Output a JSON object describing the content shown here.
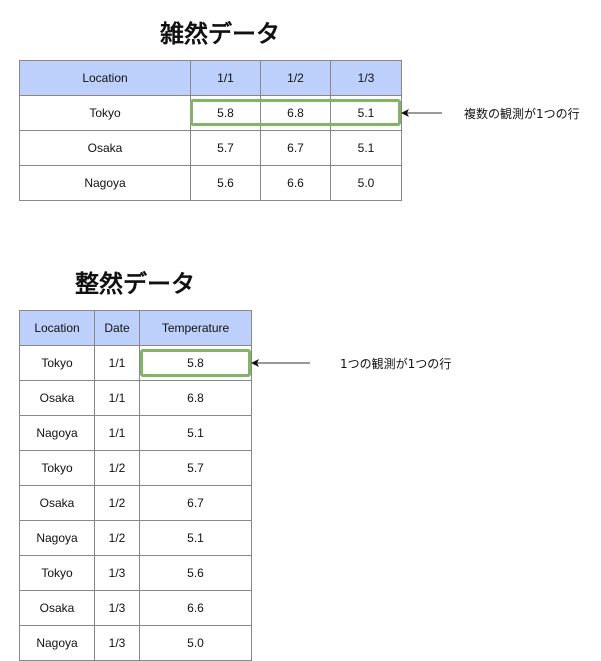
{
  "messy": {
    "title": "雑然データ",
    "headers": [
      "Location",
      "1/1",
      "1/2",
      "1/3"
    ],
    "rows": [
      [
        "Tokyo",
        "5.8",
        "6.8",
        "5.1"
      ],
      [
        "Osaka",
        "5.7",
        "6.7",
        "5.1"
      ],
      [
        "Nagoya",
        "5.6",
        "6.6",
        "5.0"
      ]
    ],
    "annotation": "複数の観測が1つの行"
  },
  "tidy": {
    "title": "整然データ",
    "headers": [
      "Location",
      "Date",
      "Temperature"
    ],
    "rows": [
      [
        "Tokyo",
        "1/1",
        "5.8"
      ],
      [
        "Osaka",
        "1/1",
        "6.8"
      ],
      [
        "Nagoya",
        "1/1",
        "5.1"
      ],
      [
        "Tokyo",
        "1/2",
        "5.7"
      ],
      [
        "Osaka",
        "1/2",
        "6.7"
      ],
      [
        "Nagoya",
        "1/2",
        "5.1"
      ],
      [
        "Tokyo",
        "1/3",
        "5.6"
      ],
      [
        "Osaka",
        "1/3",
        "6.6"
      ],
      [
        "Nagoya",
        "1/3",
        "5.0"
      ]
    ],
    "annotation": "1つの観測が1つの行"
  },
  "colors": {
    "header": "#bcd0fb",
    "highlight": "#82b366",
    "arrow": "#333333"
  }
}
